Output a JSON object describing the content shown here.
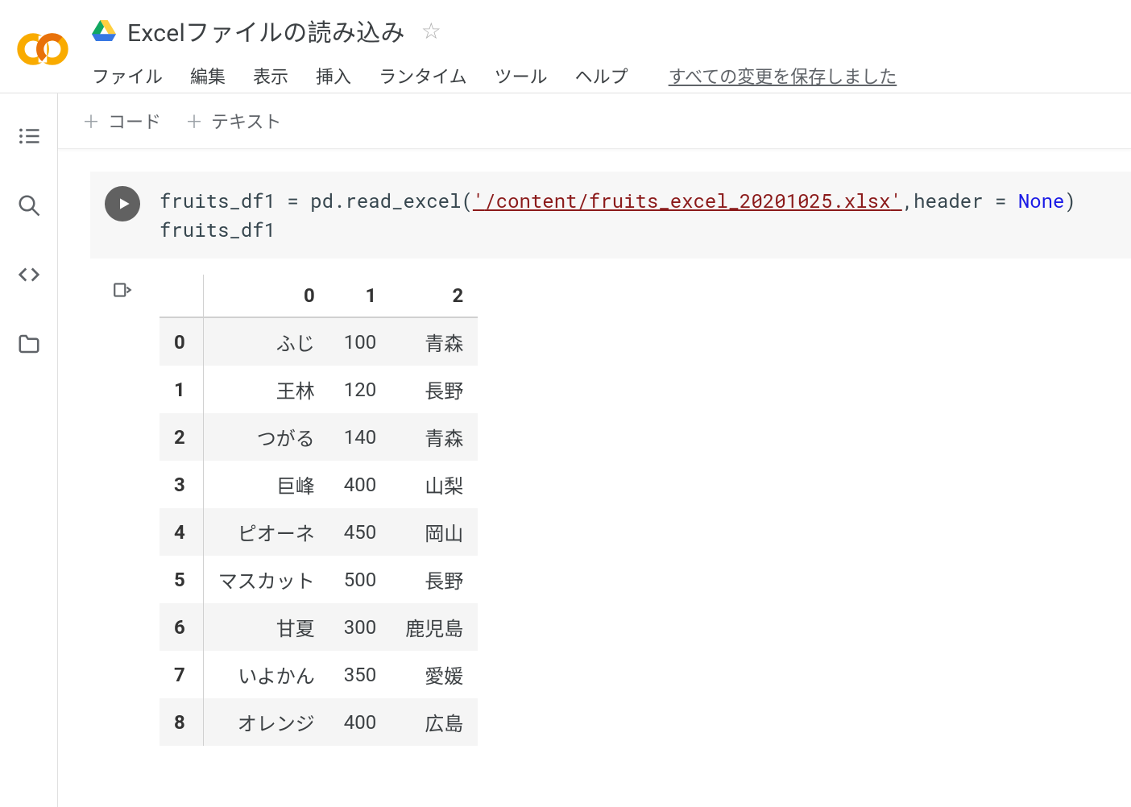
{
  "header": {
    "notebook_title": "Excelファイルの読み込み",
    "menu": {
      "file": "ファイル",
      "edit": "編集",
      "view": "表示",
      "insert": "挿入",
      "runtime": "ランタイム",
      "tools": "ツール",
      "help": "ヘルプ"
    },
    "save_status": "すべての変更を保存しました"
  },
  "toolbar": {
    "add_code": "コード",
    "add_text": "テキスト"
  },
  "cell": {
    "code_prefix1": "fruits_df1 = pd.read_excel(",
    "code_str_open": "'",
    "code_str_body": "/content/fruits_excel_20201025.xlsx",
    "code_str_close": "'",
    "code_after_str": ",header = ",
    "code_kw": "None",
    "code_suffix": ")",
    "code_line2": "fruits_df1"
  },
  "output": {
    "columns": [
      "0",
      "1",
      "2"
    ],
    "index": [
      "0",
      "1",
      "2",
      "3",
      "4",
      "5",
      "6",
      "7",
      "8"
    ],
    "rows": [
      [
        "ふじ",
        "100",
        "青森"
      ],
      [
        "王林",
        "120",
        "長野"
      ],
      [
        "つがる",
        "140",
        "青森"
      ],
      [
        "巨峰",
        "400",
        "山梨"
      ],
      [
        "ピオーネ",
        "450",
        "岡山"
      ],
      [
        "マスカット",
        "500",
        "長野"
      ],
      [
        "甘夏",
        "300",
        "鹿児島"
      ],
      [
        "いよかん",
        "350",
        "愛媛"
      ],
      [
        "オレンジ",
        "400",
        "広島"
      ]
    ]
  },
  "chart_data": {
    "type": "table",
    "title": "fruits_df1",
    "columns": [
      "0",
      "1",
      "2"
    ],
    "rows": [
      {
        "index": 0,
        "0": "ふじ",
        "1": 100,
        "2": "青森"
      },
      {
        "index": 1,
        "0": "王林",
        "1": 120,
        "2": "長野"
      },
      {
        "index": 2,
        "0": "つがる",
        "1": 140,
        "2": "青森"
      },
      {
        "index": 3,
        "0": "巨峰",
        "1": 400,
        "2": "山梨"
      },
      {
        "index": 4,
        "0": "ピオーネ",
        "1": 450,
        "2": "岡山"
      },
      {
        "index": 5,
        "0": "マスカット",
        "1": 500,
        "2": "長野"
      },
      {
        "index": 6,
        "0": "甘夏",
        "1": 300,
        "2": "鹿児島"
      },
      {
        "index": 7,
        "0": "いよかん",
        "1": 350,
        "2": "愛媛"
      },
      {
        "index": 8,
        "0": "オレンジ",
        "1": 400,
        "2": "広島"
      }
    ]
  }
}
